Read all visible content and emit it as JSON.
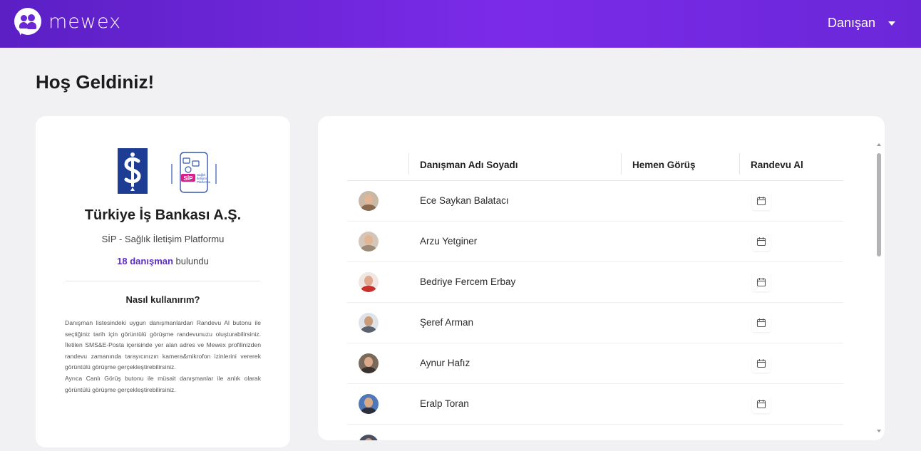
{
  "header": {
    "brand": "mewex",
    "user_menu": "Danışan"
  },
  "page_title": "Hoş Geldiniz!",
  "left_panel": {
    "company": "Türkiye İş Bankası A.Ş.",
    "platform": "SİP - Sağlık İletişim Platformu",
    "count_highlight": "18 danışman",
    "count_rest": " bulundu",
    "how_to_title": "Nasıl kullanırım?",
    "how_to_text": "Danışman listesindeki uygun danışmanlardan Randevu Al butonu ile seçtiğiniz tarih için görüntülü görüşme randevunuzu oluşturabilirsiniz. İletilen SMS&E-Posta içerisinde yer alan adres ve Mewex profilinizden randevu zamanında tarayıcınızın kamera&mikrofon izinlerini vererek görüntülü görüşme gerçekleştirebilirsiniz.",
    "how_to_text2": "Ayrıca Canlı Görüş butonu ile müsait danışmanlar ile anlık olarak görüntülü görüşme gerçekleştirebilirsiniz.",
    "logo_is_text": "İş",
    "logo_sip_text": "SİP",
    "logo_sip_sub": "Sağlık İletişim Platformu"
  },
  "table": {
    "headers": {
      "name": "Danışman Adı Soyadı",
      "now": "Hemen Görüş",
      "appointment": "Randevu Al"
    },
    "rows": [
      {
        "name": "Ece Saykan Balatacı"
      },
      {
        "name": "Arzu Yetginer"
      },
      {
        "name": "Bedriye Fercem Erbay"
      },
      {
        "name": "Şeref Arman"
      },
      {
        "name": "Aynur Hafız"
      },
      {
        "name": "Eralp Toran"
      }
    ]
  },
  "colors": {
    "header_start": "#5b1fc4",
    "header_end": "#7b2be8",
    "accent": "#5b2bc4"
  },
  "icons": {
    "appointment": "calendar-icon",
    "menu": "chevron-down-icon",
    "scroll_up": "arrow-up-icon",
    "scroll_down": "arrow-down-icon"
  }
}
